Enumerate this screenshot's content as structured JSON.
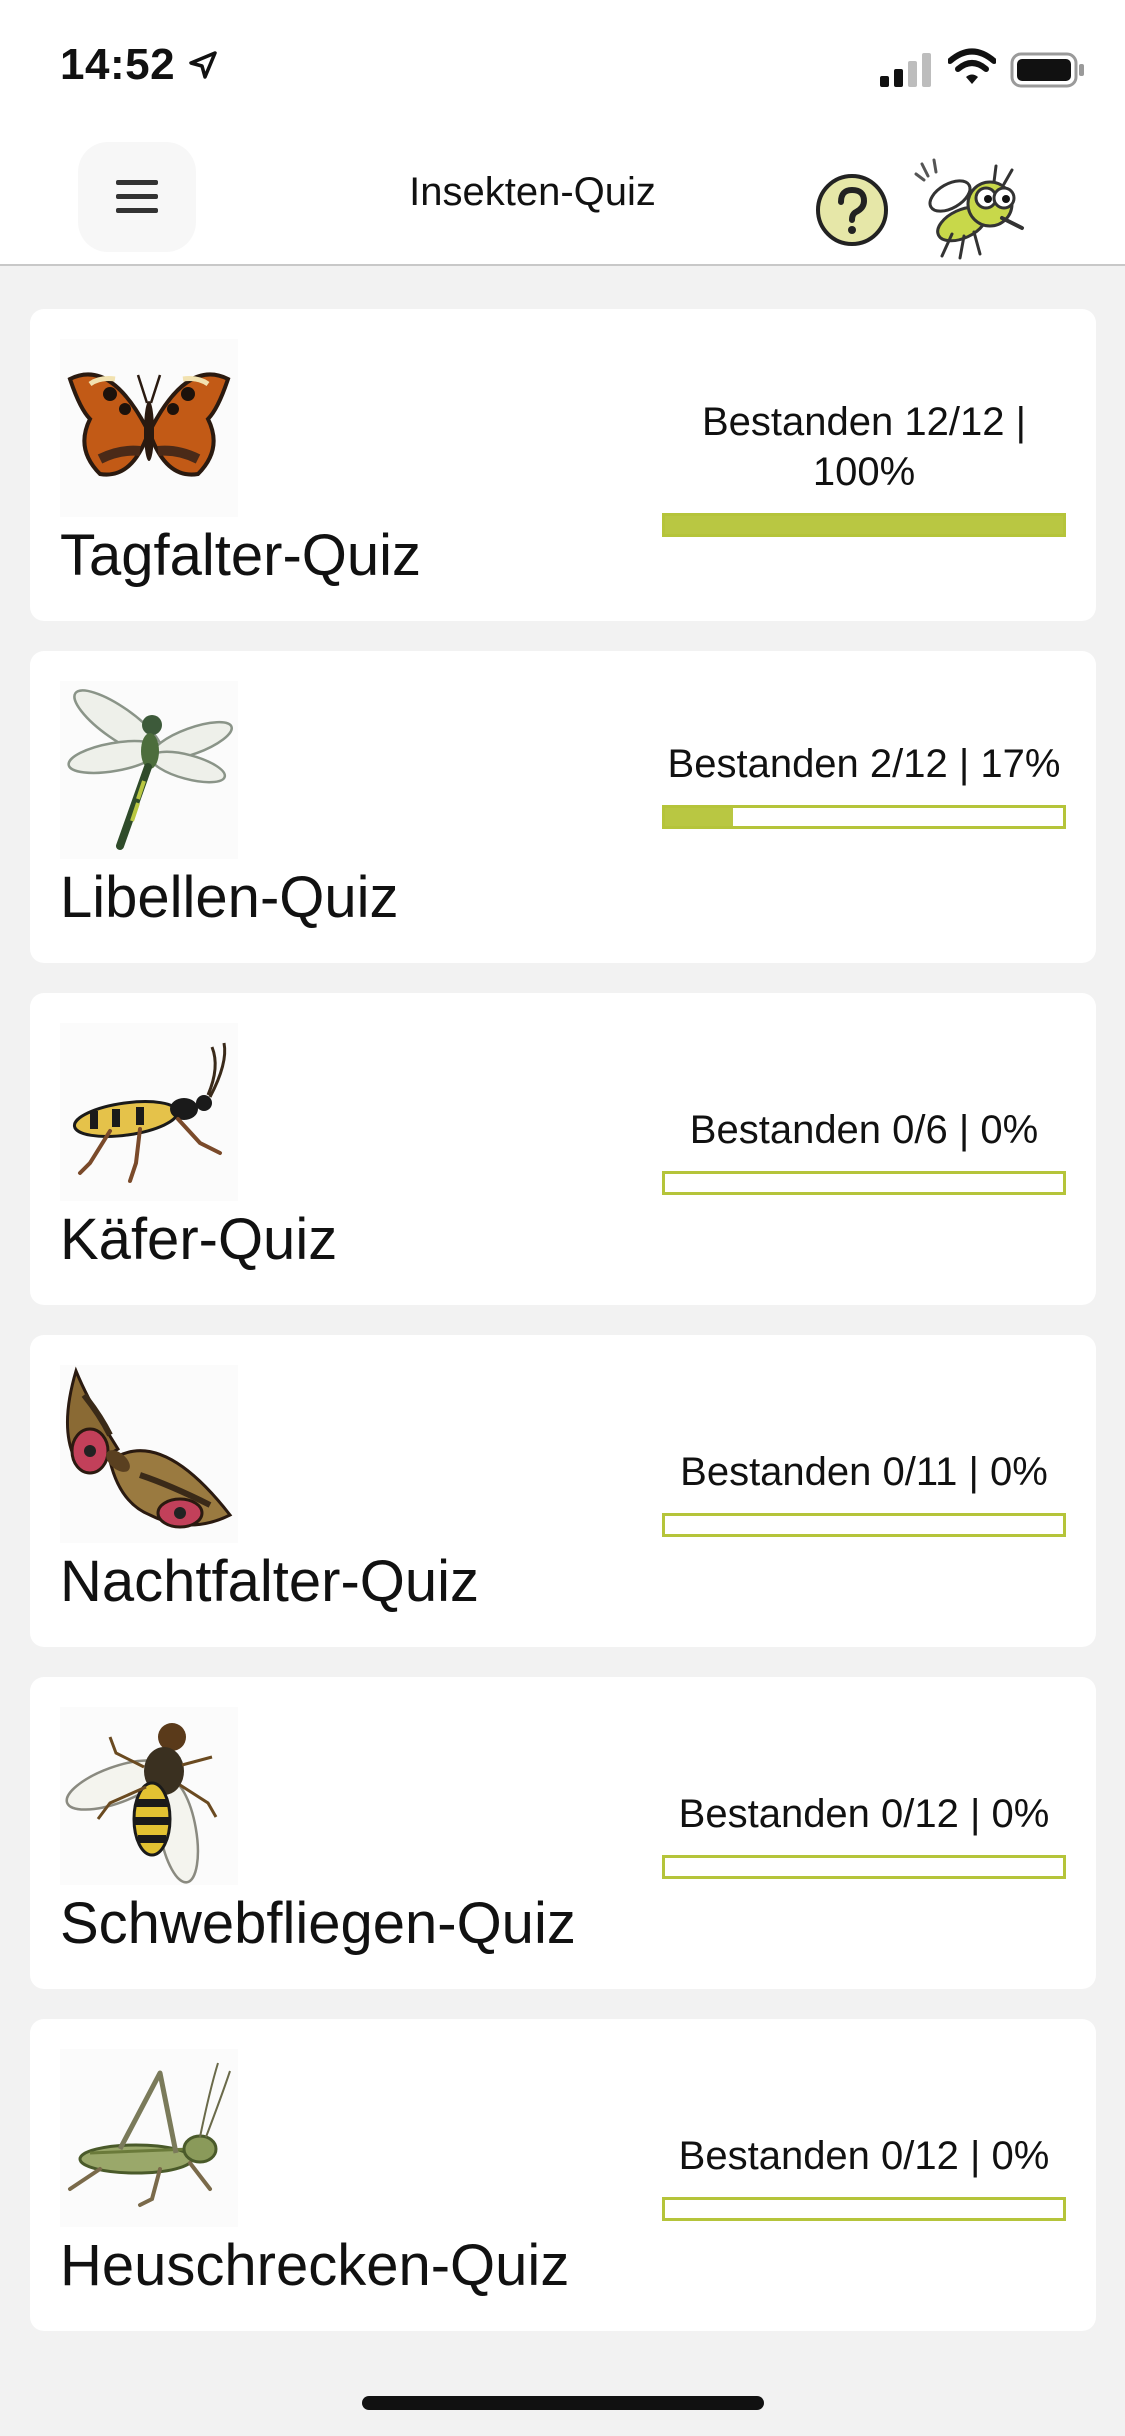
{
  "status_bar": {
    "time": "14:52"
  },
  "nav": {
    "title": "Insekten-Quiz",
    "help_icon": "help-icon",
    "menu_icon": "hamburger-icon",
    "mascot_icon": "mascot-insect-icon"
  },
  "colors": {
    "accent": "#b9c742",
    "card_bg": "#ffffff",
    "page_bg": "#f2f2f2"
  },
  "quizzes": [
    {
      "title": "Tagfalter-Quiz",
      "progress_label": "Bestanden 12/12 | 100%",
      "progress": 1.0,
      "icon": "butterfly-icon"
    },
    {
      "title": "Libellen-Quiz",
      "progress_label": "Bestanden 2/12 | 17%",
      "progress": 0.17,
      "icon": "dragonfly-icon"
    },
    {
      "title": "Käfer-Quiz",
      "progress_label": "Bestanden 0/6 | 0%",
      "progress": 0.0,
      "icon": "beetle-icon"
    },
    {
      "title": "Nachtfalter-Quiz",
      "progress_label": "Bestanden 0/11 | 0%",
      "progress": 0.0,
      "icon": "moth-icon"
    },
    {
      "title": "Schwebfliegen-Quiz",
      "progress_label": "Bestanden 0/12 | 0%",
      "progress": 0.0,
      "icon": "hoverfly-icon"
    },
    {
      "title": "Heuschrecken-Quiz",
      "progress_label": "Bestanden 0/12 | 0%",
      "progress": 0.0,
      "icon": "grasshopper-icon"
    }
  ]
}
